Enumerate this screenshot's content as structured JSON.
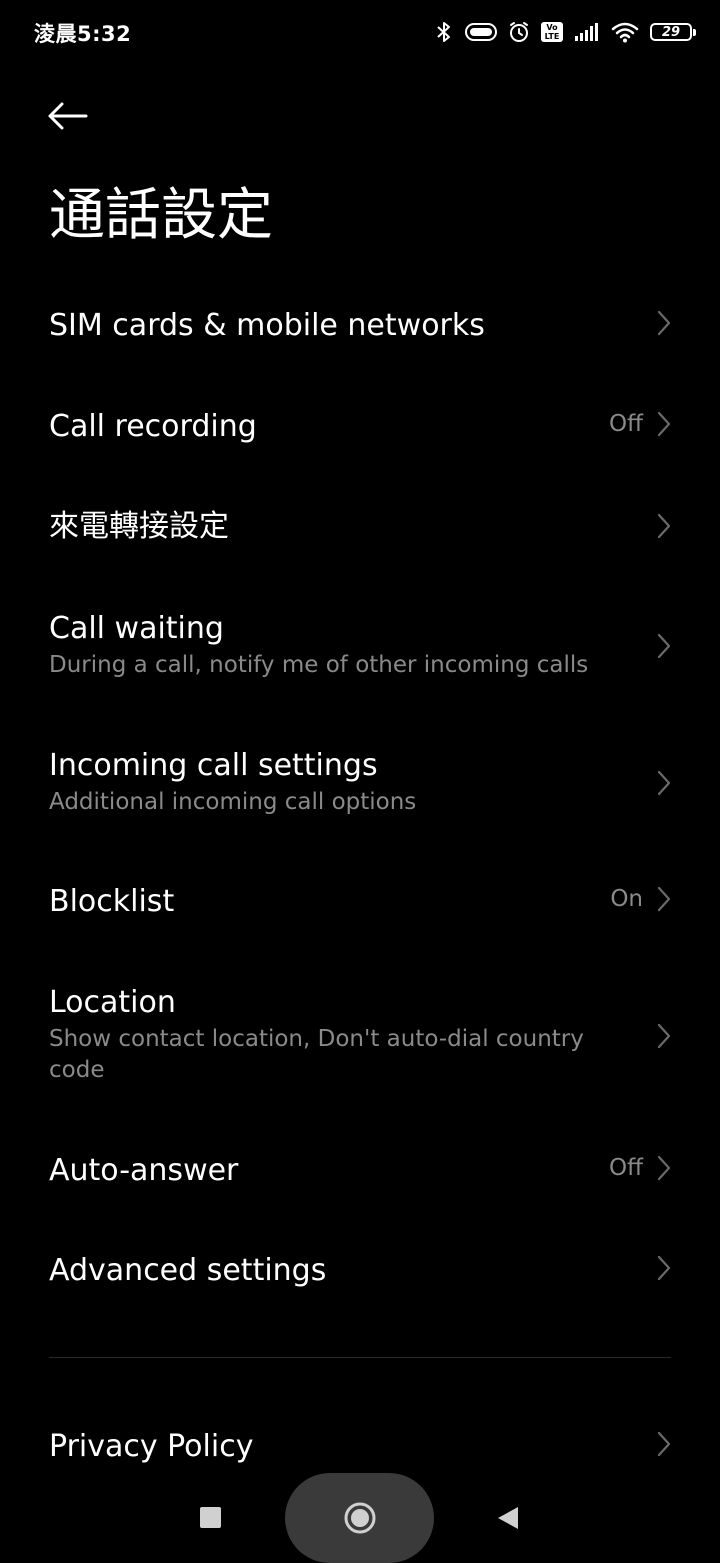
{
  "status_bar": {
    "time": "淩晨5:32",
    "battery_level": "29",
    "volte_top": "Vo",
    "volte_bottom": "LTE",
    "icons": [
      "bluetooth-icon",
      "toggle-pill-icon",
      "alarm-icon",
      "volte-icon",
      "signal-icon",
      "wifi-icon",
      "battery-icon"
    ]
  },
  "header": {
    "back_icon": "arrow-left-icon",
    "title": "通話設定"
  },
  "settings": {
    "sim_cards": {
      "title": "SIM cards & mobile networks"
    },
    "call_recording": {
      "title": "Call recording",
      "value": "Off"
    },
    "call_forwarding": {
      "title": "來電轉接設定"
    },
    "call_waiting": {
      "title": "Call waiting",
      "subtitle": "During a call, notify me of other incoming calls"
    },
    "incoming_call": {
      "title": "Incoming call settings",
      "subtitle": "Additional incoming call options"
    },
    "blocklist": {
      "title": "Blocklist",
      "value": "On"
    },
    "location": {
      "title": "Location",
      "subtitle": "Show contact location, Don't auto-dial country code"
    },
    "auto_answer": {
      "title": "Auto-answer",
      "value": "Off"
    },
    "advanced": {
      "title": "Advanced settings"
    },
    "privacy_policy": {
      "title": "Privacy Policy"
    }
  },
  "nav_bar": {
    "icons": [
      "square-recents-icon",
      "circle-home-icon",
      "triangle-back-icon"
    ]
  },
  "colors": {
    "background": "#000000",
    "text_primary": "#ffffff",
    "text_secondary": "#8a8a8a",
    "chevron": "#6a6a6a",
    "nav_pill": "#3a3a3a"
  }
}
